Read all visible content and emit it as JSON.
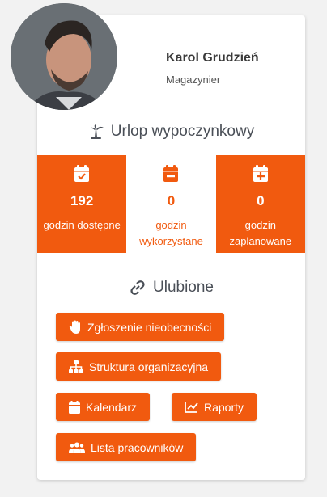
{
  "profile": {
    "name": "Karol Grudzień",
    "role": "Magazynier"
  },
  "vacation": {
    "title": "Urlop wypoczynkowy",
    "stats": [
      {
        "value": "192",
        "label": "godzin dostępne",
        "icon": "calendar-check-icon"
      },
      {
        "value": "0",
        "label": "godzin wykorzystane",
        "icon": "calendar-minus-icon"
      },
      {
        "value": "0",
        "label": "godzin zaplanowane",
        "icon": "calendar-plus-icon"
      }
    ]
  },
  "favorites": {
    "title": "Ulubione",
    "buttons": [
      {
        "label": "Zgłoszenie nieobecności",
        "icon": "hand-icon"
      },
      {
        "label": "Struktura organizacyjna",
        "icon": "sitemap-icon"
      },
      {
        "label": "Kalendarz",
        "icon": "calendar-icon"
      },
      {
        "label": "Raporty",
        "icon": "chart-line-icon"
      },
      {
        "label": "Lista pracowników",
        "icon": "users-icon"
      }
    ]
  },
  "colors": {
    "accent": "#f15a0f",
    "text": "#3a3a3a",
    "background": "#f2f2f2"
  }
}
